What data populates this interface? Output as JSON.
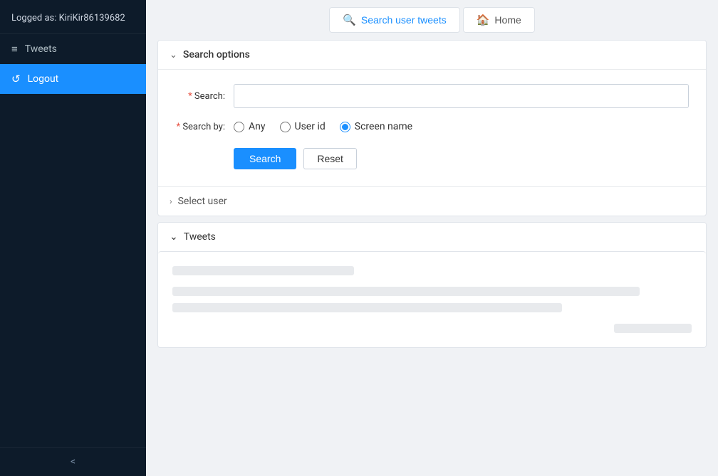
{
  "sidebar": {
    "user_label": "Logged as: KiriKir86139682",
    "items": [
      {
        "id": "tweets",
        "label": "Tweets",
        "icon": "≡",
        "active": false
      },
      {
        "id": "logout",
        "label": "Logout",
        "icon": "↺",
        "active": true
      }
    ],
    "collapse_icon": "<"
  },
  "topbar": {
    "search_btn": "Search user tweets",
    "home_btn": "Home",
    "search_icon": "🔍",
    "home_icon": "🏠"
  },
  "search_options": {
    "section_title": "Search options",
    "search_label": "* Search:",
    "search_placeholder": "",
    "search_by_label": "* Search by:",
    "radio_options": [
      {
        "id": "any",
        "label": "Any",
        "checked": false
      },
      {
        "id": "user_id",
        "label": "User id",
        "checked": false
      },
      {
        "id": "screen_name",
        "label": "Screen name",
        "checked": true
      }
    ],
    "search_btn": "Search",
    "reset_btn": "Reset"
  },
  "select_user": {
    "label": "Select user"
  },
  "tweets": {
    "section_title": "Tweets"
  }
}
